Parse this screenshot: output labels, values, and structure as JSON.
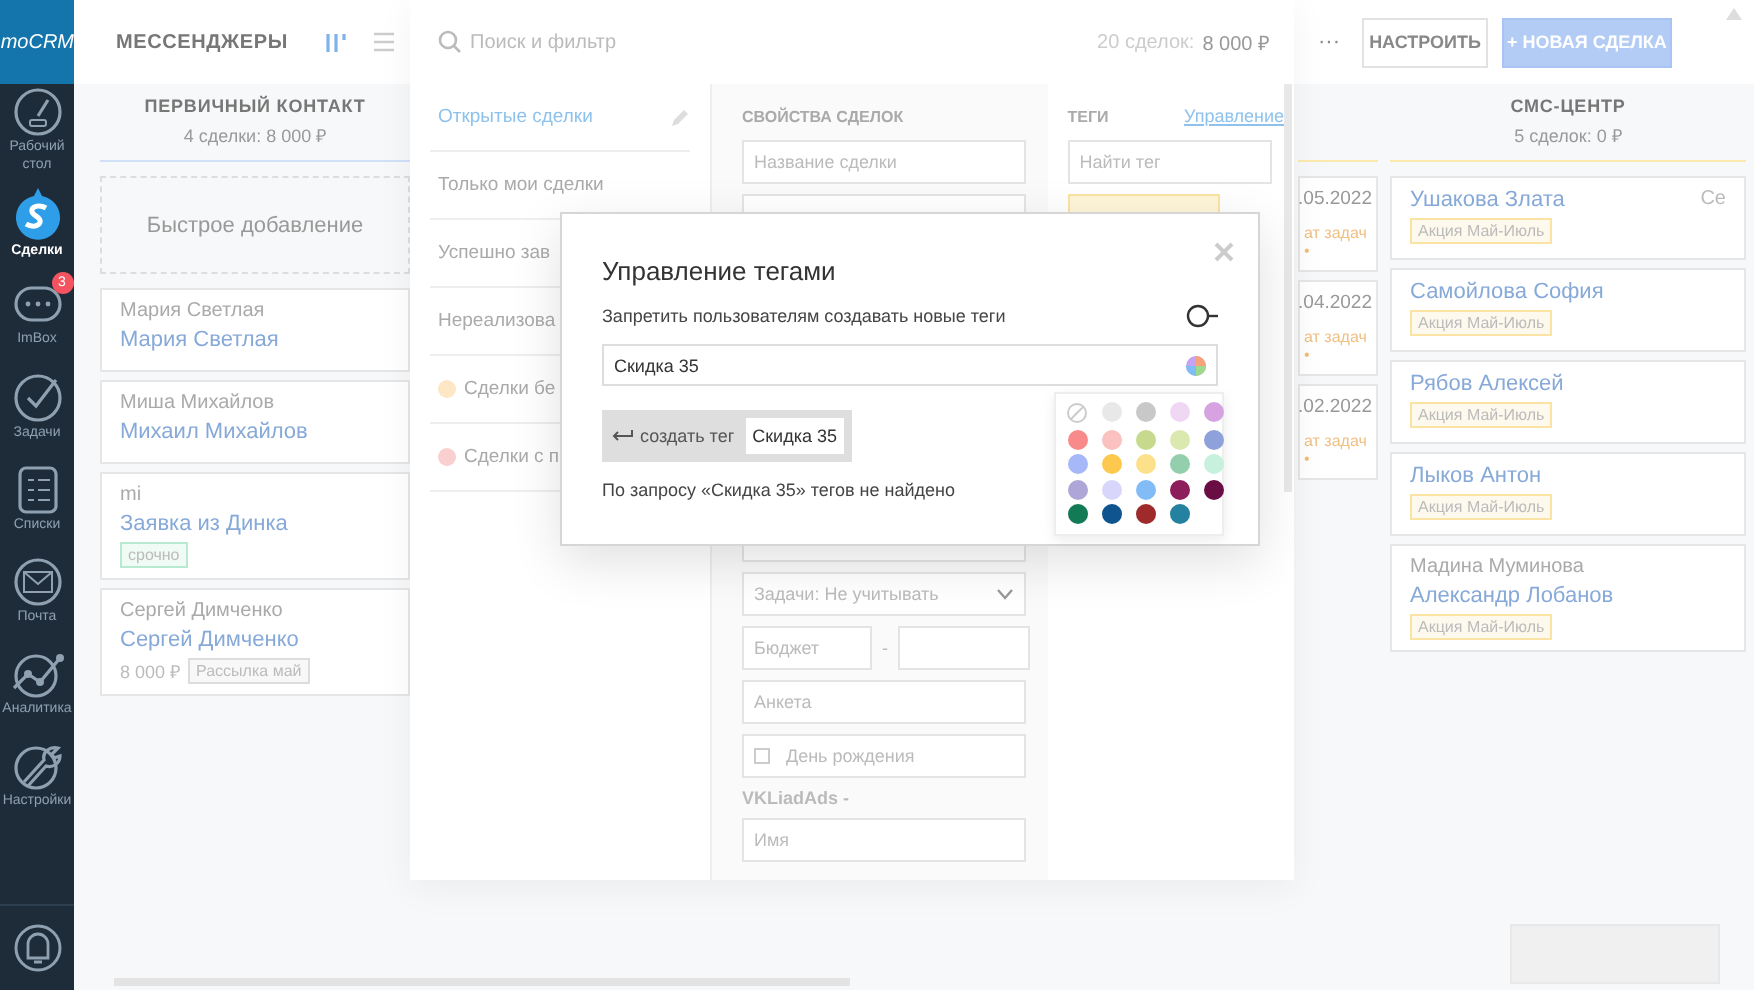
{
  "nav": {
    "logo": "moCRM",
    "items": [
      {
        "label": "Рабочий стол",
        "selected": false
      },
      {
        "label": "Сделки",
        "selected": true
      },
      {
        "label": "ImBox",
        "selected": false,
        "badge": "3"
      },
      {
        "label": "Задачи",
        "selected": false
      },
      {
        "label": "Списки",
        "selected": false
      },
      {
        "label": "Почта",
        "selected": false
      },
      {
        "label": "Аналитика",
        "selected": false
      },
      {
        "label": "Настройки",
        "selected": false
      }
    ]
  },
  "header": {
    "title": "МЕССЕНДЖЕРЫ",
    "more": "···",
    "configure_button": "НАСТРОИТЬ",
    "new_deal_button": "+ НОВАЯ СДЕЛКА"
  },
  "board": {
    "columns": [
      {
        "title": "ПЕРВИЧНЫЙ КОНТАКТ",
        "summary": "4 сделки: 8 000 ₽",
        "quick_add": "Быстрое добавление",
        "cards": [
          {
            "contact": "Мария Светлая",
            "title": "Мария Светлая"
          },
          {
            "contact": "Миша Михайлов",
            "title": "Михаил Михайлов"
          },
          {
            "contact": "mi",
            "title": "Заявка из Динка",
            "tags": [
              {
                "label": "срочно",
                "color": "#b8ead2"
              }
            ]
          },
          {
            "contact": "Сергей Димченко",
            "title": "Сергей Димченко",
            "price": "8 000 ₽",
            "tags": [
              {
                "label": "Рассылка май",
                "color": "#dddddd"
              }
            ]
          }
        ]
      },
      {
        "cards": [
          {
            "date": ".05.2022",
            "note": "ат задач •"
          },
          {
            "date": ".04.2022",
            "note": "ат задач •"
          },
          {
            "date": ".02.2022",
            "note": "ат задач •"
          }
        ]
      },
      {
        "title": "СМС-ЦЕНТР",
        "summary": "5 сделок: 0 ₽",
        "cards": [
          {
            "title": "Ушакова Злата",
            "side": "Се",
            "tags": [
              {
                "label": "Акция Май-Июль",
                "color": "#fbe3a4"
              }
            ]
          },
          {
            "title": "Самойлова София",
            "tags": [
              {
                "label": "Акция Май-Июль",
                "color": "#fbe3a4"
              }
            ]
          },
          {
            "title": "Рябов Алексей",
            "tags": [
              {
                "label": "Акция Май-Июль",
                "color": "#fbe3a4"
              }
            ]
          },
          {
            "title": "Лыков Антон",
            "tags": [
              {
                "label": "Акция Май-Июль",
                "color": "#fbe3a4"
              }
            ]
          },
          {
            "contact": "Мадина Муминова",
            "title": "Александр Лобанов",
            "tags": [
              {
                "label": "Акция Май-Июль",
                "color": "#fbe3a4"
              }
            ]
          }
        ]
      }
    ]
  },
  "filter_panel": {
    "search": {
      "placeholder": "Поиск и фильтр"
    },
    "count": "20 сделок:",
    "sum": "8 000 ₽",
    "presets": [
      {
        "label": "Открытые сделки",
        "selected": true
      },
      {
        "label": "Только мои сделки",
        "selected": false
      },
      {
        "label": "Успешно зав",
        "selected": false
      },
      {
        "label": "Нереализова",
        "selected": false
      },
      {
        "label": "Сделки бе",
        "selected": false,
        "color": "#fde7c4"
      },
      {
        "label": "Сделки с п",
        "selected": false,
        "color": "#f9cfcf"
      }
    ],
    "properties_heading": "СВОЙСТВА СДЕЛОК",
    "name_field": {
      "placeholder": "Название сделки"
    },
    "tasks_select": {
      "value": "Задачи: Не учитывать"
    },
    "budget": {
      "placeholder": "Бюджет",
      "separator": "-"
    },
    "form_field": {
      "placeholder": "Анкета"
    },
    "birthday": {
      "placeholder": "День рождения"
    },
    "group_label": "VKLiadAds -",
    "first_name": {
      "placeholder": "Имя"
    },
    "tags_heading": "ТЕГИ",
    "manage_link": "Управление",
    "tag_search": {
      "placeholder": "Найти тег"
    }
  },
  "modal": {
    "title": "Управление тегами",
    "toggle": {
      "label": "Запретить пользователям создавать новые теги",
      "on": false
    },
    "input": {
      "value": "Скидка 35"
    },
    "create_button": "создать тег",
    "create_chip": "Скидка 35",
    "not_found": "По запросу «Скидка 35» тегов не найдено",
    "palette": [
      {
        "kind": "none"
      },
      {
        "kind": "color",
        "color": "#e8e8e8"
      },
      {
        "kind": "color",
        "color": "#c8c8c8"
      },
      {
        "kind": "color",
        "color": "#f0d8f4"
      },
      {
        "kind": "color",
        "color": "#d6a3e0"
      },
      {
        "kind": "color",
        "color": "#f88a8a"
      },
      {
        "kind": "color",
        "color": "#fbc1c1"
      },
      {
        "kind": "color",
        "color": "#c6d98d"
      },
      {
        "kind": "color",
        "color": "#dbe8b0"
      },
      {
        "kind": "color",
        "color": "#8fa1da"
      },
      {
        "kind": "color",
        "color": "#a6b8f8"
      },
      {
        "kind": "color",
        "color": "#fdc84e"
      },
      {
        "kind": "color",
        "color": "#fde08a"
      },
      {
        "kind": "color",
        "color": "#94cfad"
      },
      {
        "kind": "color",
        "color": "#c7f0dd"
      },
      {
        "kind": "color",
        "color": "#ada6d6"
      },
      {
        "kind": "color",
        "color": "#d9d6fb"
      },
      {
        "kind": "color",
        "color": "#82bcf7"
      },
      {
        "kind": "color",
        "color": "#8e1d5c"
      },
      {
        "kind": "color",
        "color": "#6a0d45"
      },
      {
        "kind": "color",
        "color": "#137a56"
      },
      {
        "kind": "color",
        "color": "#0f548f"
      },
      {
        "kind": "color",
        "color": "#9e2a2a"
      },
      {
        "kind": "color",
        "color": "#24819f"
      }
    ]
  }
}
